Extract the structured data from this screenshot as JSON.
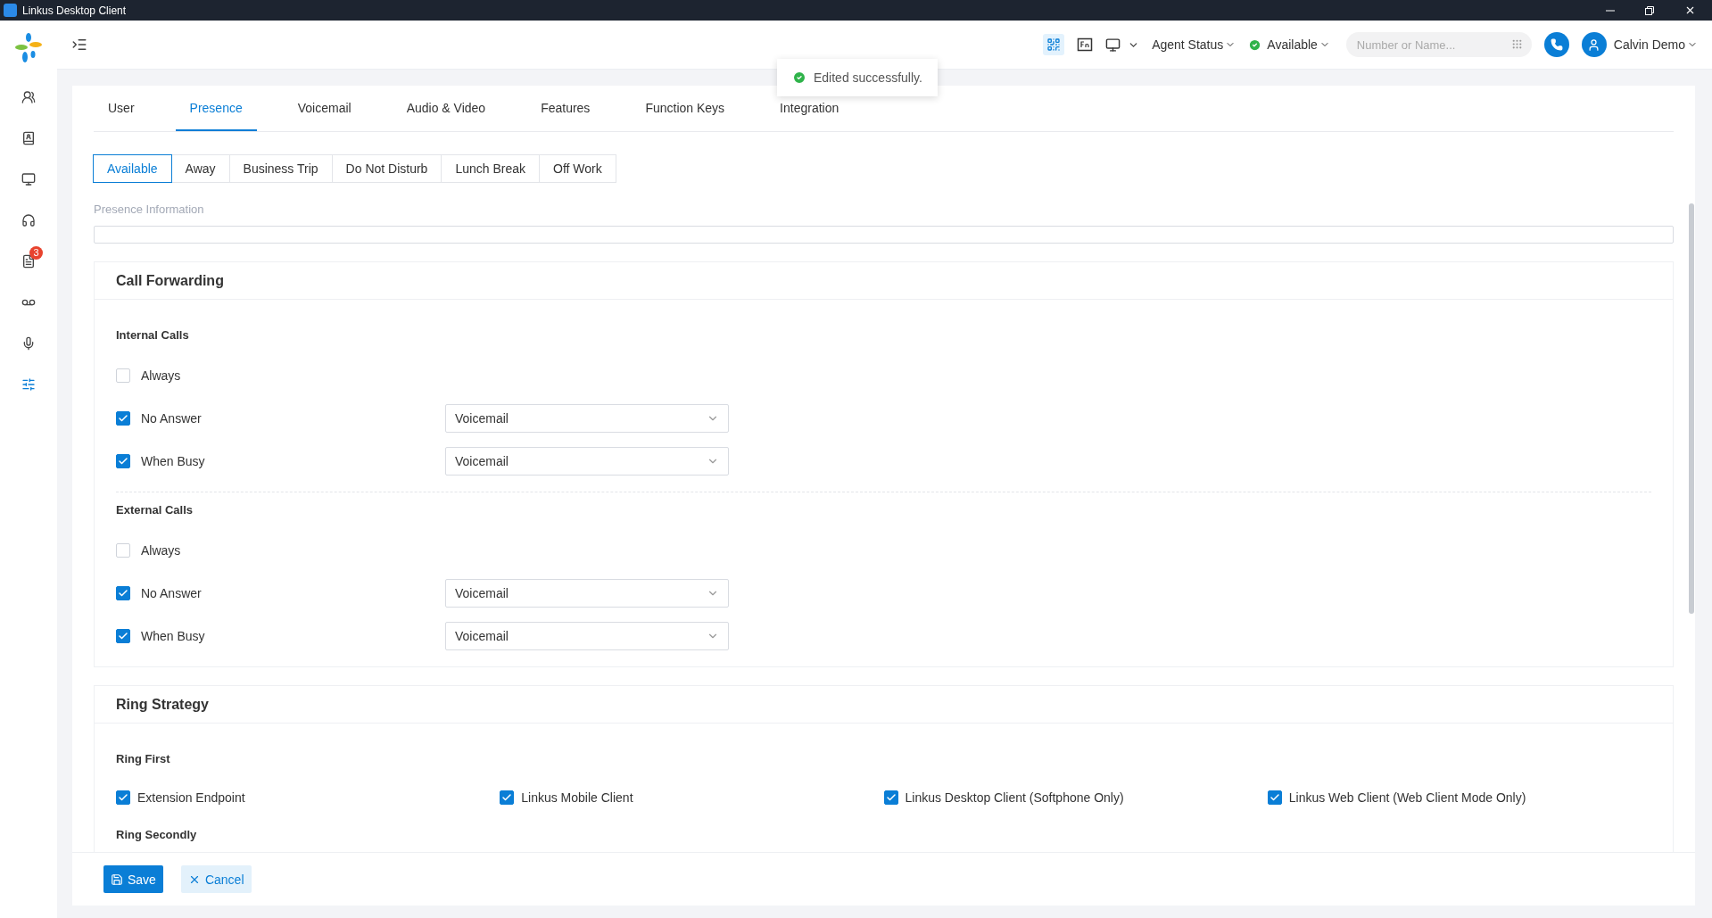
{
  "window": {
    "title": "Linkus Desktop Client"
  },
  "sidebar": {
    "items": [
      {
        "selected": false
      },
      {
        "selected": false
      },
      {
        "selected": false
      },
      {
        "selected": false
      },
      {
        "selected": false,
        "badge": "3"
      },
      {
        "selected": false
      },
      {
        "selected": false
      },
      {
        "selected": true
      }
    ]
  },
  "header": {
    "agent_status": "Agent Status",
    "presence": "Available",
    "search": {
      "placeholder": "Number or Name..."
    },
    "user": "Calvin Demo"
  },
  "toast": "Edited successfully.",
  "tabs": [
    {
      "label": "User",
      "selected": false
    },
    {
      "label": "Presence",
      "selected": true
    },
    {
      "label": "Voicemail",
      "selected": false
    },
    {
      "label": "Audio & Video",
      "selected": false
    },
    {
      "label": "Features",
      "selected": false
    },
    {
      "label": "Function Keys",
      "selected": false
    },
    {
      "label": "Integration",
      "selected": false
    }
  ],
  "presence_options": [
    {
      "label": "Available",
      "selected": true
    },
    {
      "label": "Away",
      "selected": false
    },
    {
      "label": "Business Trip",
      "selected": false
    },
    {
      "label": "Do Not Disturb",
      "selected": false
    },
    {
      "label": "Lunch Break",
      "selected": false
    },
    {
      "label": "Off Work",
      "selected": false
    }
  ],
  "presence_information": {
    "label": "Presence Information"
  },
  "call_forwarding": {
    "title": "Call Forwarding",
    "groups": [
      {
        "title": "Internal Calls",
        "rules": [
          {
            "label": "Always",
            "checked": false
          },
          {
            "label": "No Answer",
            "checked": true,
            "destination": "Voicemail"
          },
          {
            "label": "When Busy",
            "checked": true,
            "destination": "Voicemail"
          }
        ]
      },
      {
        "title": "External Calls",
        "rules": [
          {
            "label": "Always",
            "checked": false
          },
          {
            "label": "No Answer",
            "checked": true,
            "destination": "Voicemail"
          },
          {
            "label": "When Busy",
            "checked": true,
            "destination": "Voicemail"
          }
        ]
      }
    ]
  },
  "ring_strategy": {
    "title": "Ring Strategy",
    "ring_first": {
      "title": "Ring First",
      "endpoints": [
        {
          "label": "Extension Endpoint",
          "checked": true
        },
        {
          "label": "Linkus Mobile Client",
          "checked": true
        },
        {
          "label": "Linkus Desktop Client (Softphone Only)",
          "checked": true
        },
        {
          "label": "Linkus Web Client (Web Client Mode Only)",
          "checked": true
        }
      ]
    },
    "ring_secondly": {
      "title": "Ring Secondly"
    }
  },
  "footer": {
    "buttons": [
      {
        "kind": "primary",
        "label": "Save"
      },
      {
        "kind": "secondary",
        "label": "Cancel"
      }
    ]
  }
}
